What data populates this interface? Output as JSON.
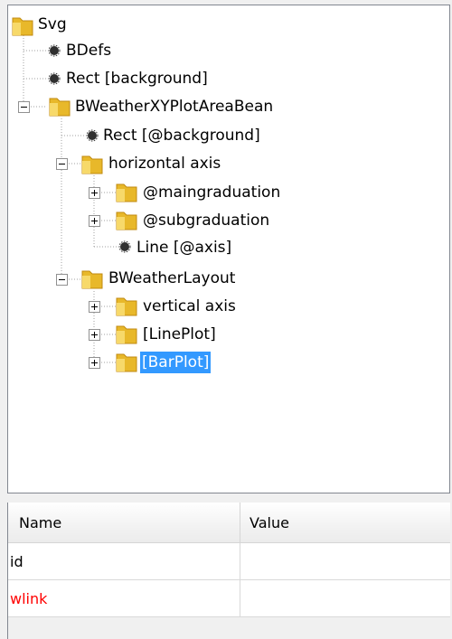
{
  "tree": {
    "nodes": [
      {
        "label": "Svg",
        "icon": "folder-icon",
        "expander": "none"
      },
      {
        "label": "BDefs",
        "icon": "leaf-node-icon",
        "expander": "none"
      },
      {
        "label": "Rect [background]",
        "icon": "leaf-node-icon",
        "expander": "none"
      },
      {
        "label": "BWeatherXYPlotAreaBean",
        "icon": "folder-icon",
        "expander": "collapse"
      },
      {
        "label": "Rect [@background]",
        "icon": "leaf-node-icon",
        "expander": "none"
      },
      {
        "label": "horizontal axis",
        "icon": "folder-icon",
        "expander": "collapse"
      },
      {
        "label": "@maingraduation",
        "icon": "folder-icon",
        "expander": "expand"
      },
      {
        "label": "@subgraduation",
        "icon": "folder-icon",
        "expander": "expand"
      },
      {
        "label": "Line [@axis]",
        "icon": "leaf-node-icon",
        "expander": "none"
      },
      {
        "label": "BWeatherLayout",
        "icon": "folder-icon",
        "expander": "collapse"
      },
      {
        "label": "vertical axis",
        "icon": "folder-icon",
        "expander": "expand"
      },
      {
        "label": "[LinePlot]",
        "icon": "folder-icon",
        "expander": "expand"
      },
      {
        "label": "[BarPlot]",
        "icon": "folder-icon",
        "expander": "expand",
        "selected": true
      }
    ]
  },
  "properties": {
    "columns": [
      "Name",
      "Value"
    ],
    "rows": [
      {
        "name": "id",
        "value": "",
        "name_color": "#000000"
      },
      {
        "name": "wlink",
        "value": "",
        "name_color": "#ff0000"
      }
    ]
  },
  "colors": {
    "selection": "#3399ff",
    "folder": "#e8b82a",
    "required_property": "#ff0000"
  }
}
